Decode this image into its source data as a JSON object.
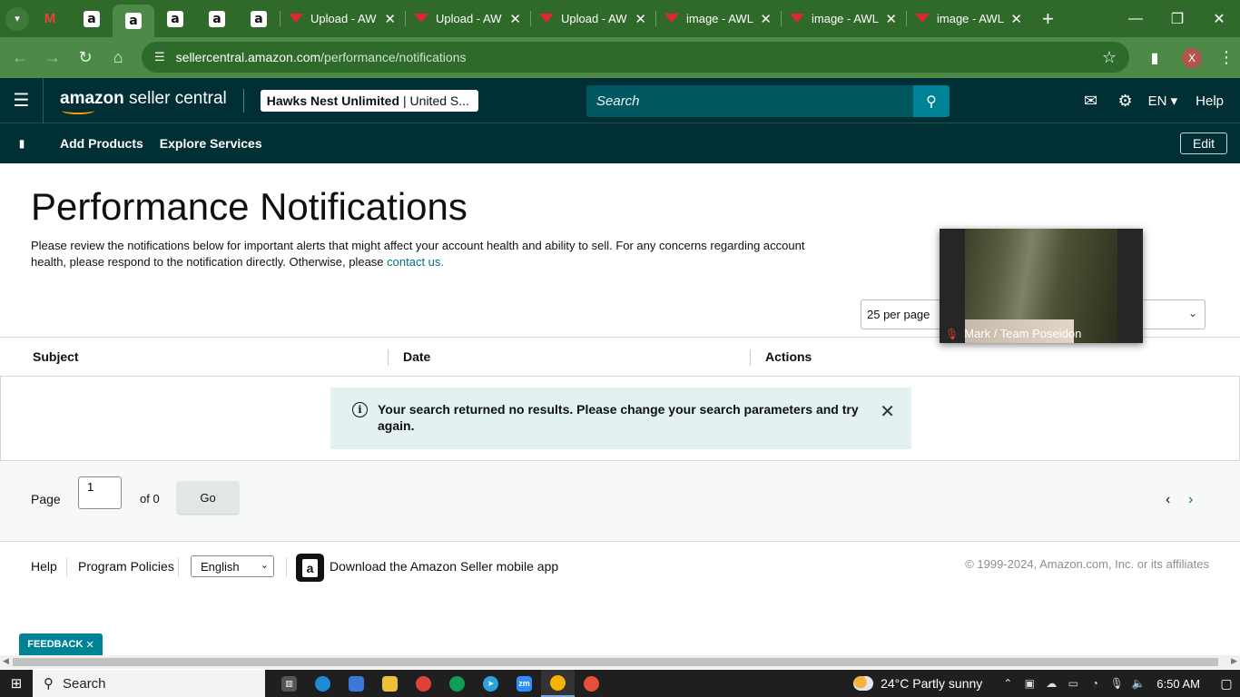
{
  "browser": {
    "tabs": [
      {
        "title": "Upload - AW"
      },
      {
        "title": "Upload - AW"
      },
      {
        "title": "Upload - AW"
      },
      {
        "title": "image - AWL"
      },
      {
        "title": "image - AWL"
      },
      {
        "title": "image - AWL"
      }
    ],
    "url_host": "sellercentral.amazon.com",
    "url_path": "/performance/notifications",
    "profile_initial": "X"
  },
  "header": {
    "logo_bold": "amazon",
    "logo_rest": " seller central",
    "account_name": "Hawks Nest Unlimited",
    "account_region": "| United S...",
    "search_placeholder": "Search",
    "language": "EN",
    "help": "Help"
  },
  "subnav": {
    "add_products": "Add Products",
    "explore_services": "Explore Services",
    "edit": "Edit"
  },
  "main": {
    "title": "Performance Notifications",
    "intro": "Please review the notifications below for important alerts that might affect your account health and ability to sell. For any concerns regarding account health, please respond to the notification directly. Otherwise, please ",
    "contact_link": "contact us.",
    "per_page": "25 per page",
    "columns": [
      "Subject",
      "Date",
      "Actions"
    ],
    "no_results": "Your search returned no results. Please change your search parameters and try again."
  },
  "pager": {
    "page_label": "Page",
    "page_value": "1",
    "of_label": "of 0",
    "go": "Go"
  },
  "footer": {
    "help": "Help",
    "program_policies": "Program Policies",
    "language": "English",
    "app_text": "Download the Amazon Seller mobile app",
    "copyright": "© 1999-2024, Amazon.com, Inc. or its affiliates"
  },
  "feedback": "FEEDBACK",
  "video": {
    "caption": "Mark / Team Poseidon"
  },
  "taskbar": {
    "search": "Search",
    "weather": "24°C  Partly sunny",
    "time": "6:50 AM"
  },
  "colors": {
    "header_bg": "#002f36",
    "accent": "#008296",
    "link": "#007185",
    "browser_frame": "#2f6a2b"
  }
}
